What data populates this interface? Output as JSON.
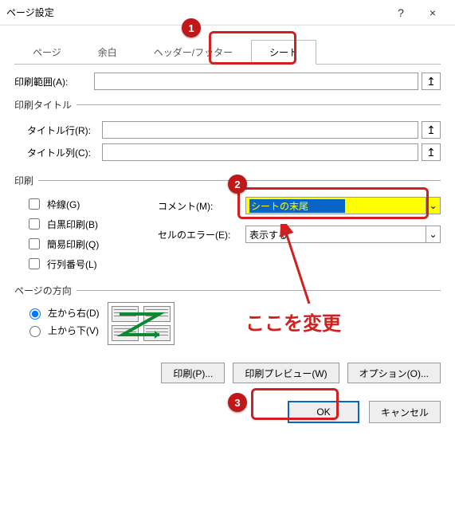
{
  "titlebar": {
    "title": "ページ設定",
    "help": "?",
    "close": "×"
  },
  "tabs": {
    "page": "ページ",
    "margins": "余白",
    "headerfooter": "ヘッダー/フッター",
    "sheet": "シート"
  },
  "print_area": {
    "label": "印刷範囲(A):"
  },
  "print_titles": {
    "legend": "印刷タイトル",
    "rows_label": "タイトル行(R):",
    "cols_label": "タイトル列(C):"
  },
  "print": {
    "legend": "印刷",
    "gridlines": "枠線(G)",
    "bw": "白黒印刷(B)",
    "draft": "簡易印刷(Q)",
    "rowcol": "行列番号(L)",
    "comment_label": "コメント(M):",
    "comment_value": "シートの末尾",
    "cellerr_label": "セルのエラー(E):",
    "cellerr_value": "表示する"
  },
  "order": {
    "legend": "ページの方向",
    "lr": "左から右(D)",
    "tb": "上から下(V)"
  },
  "buttons": {
    "print": "印刷(P)...",
    "preview": "印刷プレビュー(W)",
    "options": "オプション(O)..."
  },
  "footer": {
    "ok": "OK",
    "cancel": "キャンセル"
  },
  "annotation": {
    "b1": "1",
    "b2": "2",
    "b3": "3",
    "text": "ここを変更"
  }
}
